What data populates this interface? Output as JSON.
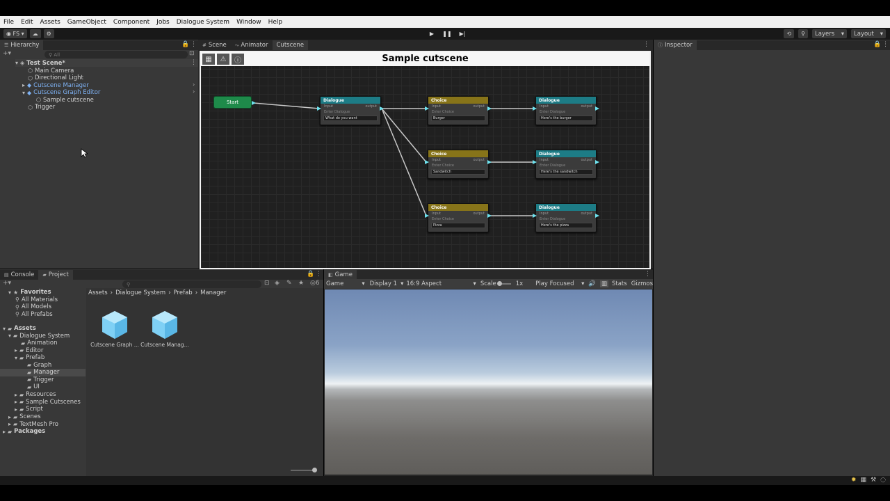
{
  "menu": [
    "File",
    "Edit",
    "Assets",
    "GameObject",
    "Component",
    "Jobs",
    "Dialogue System",
    "Window",
    "Help"
  ],
  "toolbar": {
    "account_label": "FS",
    "play_icon": "▶",
    "pause_icon": "❚❚",
    "step_icon": "▶|",
    "layers_label": "Layers",
    "layout_label": "Layout"
  },
  "hierarchy": {
    "tab": "Hierarchy",
    "search_placeholder": "All",
    "items": [
      {
        "label": "Test Scene*"
      },
      {
        "label": "Main Camera"
      },
      {
        "label": "Directional Light"
      },
      {
        "label": "Cutscene Manager"
      },
      {
        "label": "Cutscene Graph Editor"
      },
      {
        "label": "Sample cutscene"
      },
      {
        "label": "Trigger"
      }
    ]
  },
  "center_tabs": [
    "Scene",
    "Animator",
    "Cutscene"
  ],
  "graph": {
    "title": "Sample cutscene",
    "start_label": "Start",
    "input_label": "Input",
    "output_label": "output",
    "nodes": [
      {
        "type": "Dialogue",
        "field_label": "Enter Dialogue",
        "value": "What do you want"
      },
      {
        "type": "Choice",
        "field_label": "Enter Choice",
        "value": "Burger"
      },
      {
        "type": "Choice",
        "field_label": "Enter Choice",
        "value": "Sandwitch"
      },
      {
        "type": "Choice",
        "field_label": "Enter Choice",
        "value": "Pizza"
      },
      {
        "type": "Dialogue",
        "field_label": "Enter Dialogue",
        "value": "Here's the burger"
      },
      {
        "type": "Dialogue",
        "field_label": "Enter Dialogue",
        "value": "Here's the sandwitch"
      },
      {
        "type": "Dialogue",
        "field_label": "Enter Dialogue",
        "value": "Here's the pizza"
      }
    ]
  },
  "inspector": {
    "tab": "Inspector"
  },
  "project": {
    "tabs": [
      "Console",
      "Project"
    ],
    "hidden_count": "6",
    "breadcrumb": [
      "Assets",
      "Dialogue System",
      "Prefab",
      "Manager"
    ],
    "tree": [
      {
        "label": "Favorites",
        "bold": true
      },
      {
        "label": "All Materials"
      },
      {
        "label": "All Models"
      },
      {
        "label": "All Prefabs"
      },
      {
        "label": "Assets",
        "bold": true
      },
      {
        "label": "Dialogue System"
      },
      {
        "label": "Animation"
      },
      {
        "label": "Editor"
      },
      {
        "label": "Prefab"
      },
      {
        "label": "Graph"
      },
      {
        "label": "Manager"
      },
      {
        "label": "Trigger"
      },
      {
        "label": "UI"
      },
      {
        "label": "Resources"
      },
      {
        "label": "Sample Cutscenes"
      },
      {
        "label": "Script"
      },
      {
        "label": "Scenes"
      },
      {
        "label": "TextMesh Pro"
      },
      {
        "label": "Packages",
        "bold": true
      }
    ],
    "assets": [
      "Cutscene Graph ...",
      "Cutscene Manag..."
    ]
  },
  "game": {
    "tab": "Game",
    "mode": "Game",
    "display": "Display 1",
    "aspect": "16:9 Aspect",
    "scale_label": "Scale",
    "scale_value": "1x",
    "play_focus": "Play Focused",
    "stats": "Stats",
    "gizmos": "Gizmos"
  }
}
